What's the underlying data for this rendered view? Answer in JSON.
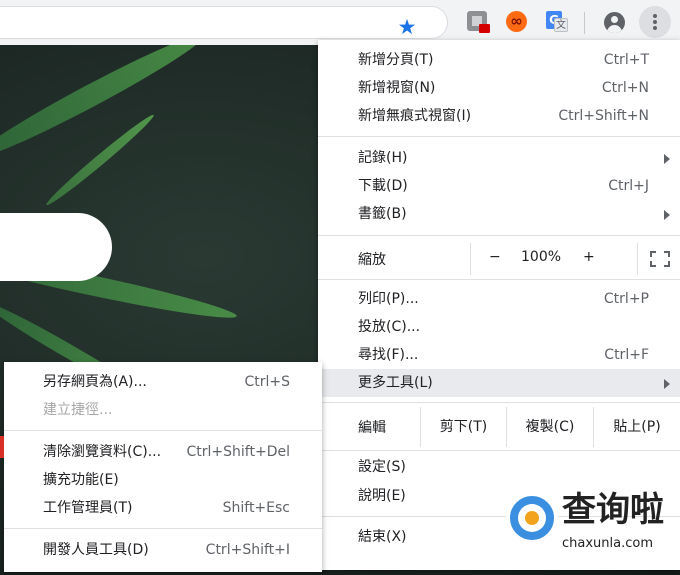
{
  "toolbar": {
    "bookmark_icon": "star-icon",
    "extensions": [
      "extension-icon",
      "infinity-icon",
      "google-translate-icon"
    ],
    "account_icon": "account-icon",
    "menu_icon": "more-vert-icon",
    "accent_color": "#1a73e8"
  },
  "main_menu": {
    "new_tab": {
      "label": "新增分頁(T)",
      "shortcut": "Ctrl+T"
    },
    "new_window": {
      "label": "新增視窗(N)",
      "shortcut": "Ctrl+N"
    },
    "new_incognito": {
      "label": "新增無痕式視窗(I)",
      "shortcut": "Ctrl+Shift+N"
    },
    "history": {
      "label": "記錄(H)"
    },
    "downloads": {
      "label": "下載(D)",
      "shortcut": "Ctrl+J"
    },
    "bookmarks": {
      "label": "書籤(B)"
    },
    "zoom": {
      "label": "縮放",
      "minus": "−",
      "value": "100%",
      "plus": "+"
    },
    "print": {
      "label": "列印(P)...",
      "shortcut": "Ctrl+P"
    },
    "cast": {
      "label": "投放(C)..."
    },
    "find": {
      "label": "尋找(F)...",
      "shortcut": "Ctrl+F"
    },
    "more_tools": {
      "label": "更多工具(L)"
    },
    "edit": {
      "label": "編輯",
      "cut": "剪下(T)",
      "copy": "複製(C)",
      "paste": "貼上(P)"
    },
    "settings": {
      "label": "設定(S)"
    },
    "help": {
      "label": "說明(E)"
    },
    "exit": {
      "label": "結束(X)"
    }
  },
  "submenu": {
    "save_page": {
      "label": "另存網頁為(A)...",
      "shortcut": "Ctrl+S"
    },
    "create_shortcut": {
      "label": "建立捷徑..."
    },
    "clear_data": {
      "label": "清除瀏覽資料(C)...",
      "shortcut": "Ctrl+Shift+Del"
    },
    "extensions": {
      "label": "擴充功能(E)"
    },
    "task_manager": {
      "label": "工作管理員(T)",
      "shortcut": "Shift+Esc"
    },
    "dev_tools": {
      "label": "開發人員工具(D)",
      "shortcut": "Ctrl+Shift+I"
    }
  },
  "watermark": {
    "title": "查询啦",
    "url": "chaxunla.com"
  }
}
